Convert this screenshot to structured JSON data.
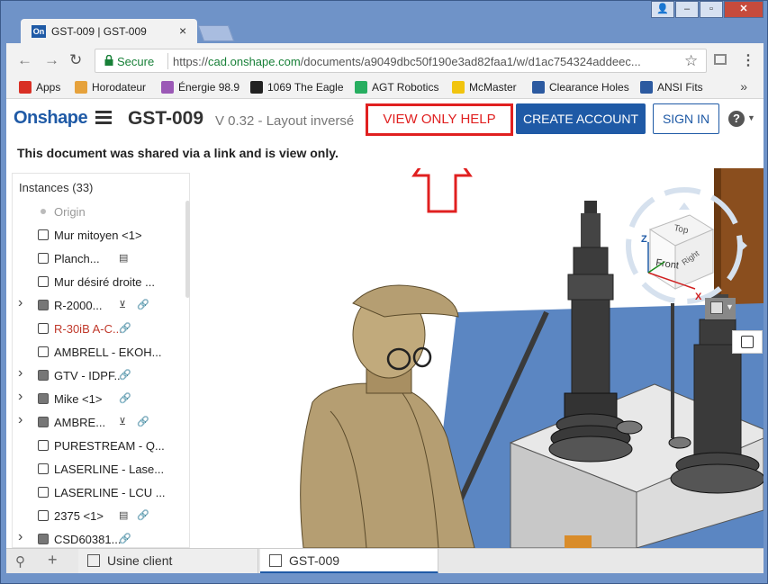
{
  "browser": {
    "tab_title": "GST-009 | GST-009",
    "tab_favicon": "On",
    "secure_label": "Secure",
    "url_prefix": "https://",
    "url_host": "cad.onshape.com",
    "url_path": "/documents/a9049dbc50f190e3ad82faa1/w/d1ac754324addeec..."
  },
  "bookmarks": [
    {
      "label": "Apps",
      "icon": "apps-grid-icon",
      "color": "#d93025"
    },
    {
      "label": "Horodateur",
      "icon": "clock-icon",
      "color": "#e6a23c"
    },
    {
      "label": "Énergie 98.9",
      "icon": "radio-icon",
      "color": "#9b59b6"
    },
    {
      "label": "1069 The Eagle",
      "icon": "radio-icon",
      "color": "#222222"
    },
    {
      "label": "AGT Robotics",
      "icon": "agt-icon",
      "color": "#27ae60"
    },
    {
      "label": "McMaster",
      "icon": "mcmaster-icon",
      "color": "#f1c40f"
    },
    {
      "label": "Clearance Holes",
      "icon": "globe-icon",
      "color": "#2c5aa0"
    },
    {
      "label": "ANSI Fits",
      "icon": "globe-icon",
      "color": "#2c5aa0"
    }
  ],
  "header": {
    "logo": "Onshape",
    "doc_title": "GST-009",
    "doc_version": "V 0.32 - Layout inversé",
    "view_only_help": "VIEW ONLY HELP",
    "create_account": "CREATE ACCOUNT",
    "sign_in": "SIGN IN",
    "help_icon": "?"
  },
  "shared_message": "This document was shared via a link and is view only.",
  "instances": {
    "title": "Instances (33)",
    "items": [
      {
        "label": "Origin",
        "type": "origin",
        "expandable": false,
        "style": "muted",
        "tags": []
      },
      {
        "label": "Mur mitoyen <1>",
        "type": "part",
        "expandable": false,
        "style": "",
        "tags": []
      },
      {
        "label": "Planch...",
        "type": "part",
        "expandable": false,
        "style": "",
        "tags": [
          "fixed"
        ]
      },
      {
        "label": "Mur désiré droite ...",
        "type": "part",
        "expandable": false,
        "style": "",
        "tags": []
      },
      {
        "label": "R-2000...",
        "type": "asm",
        "expandable": true,
        "style": "",
        "tags": [
          "ground",
          "link"
        ]
      },
      {
        "label": "R-30iB A-C...",
        "type": "part",
        "expandable": false,
        "style": "red",
        "tags": [
          "link"
        ]
      },
      {
        "label": "AMBRELL - EKOH...",
        "type": "part",
        "expandable": false,
        "style": "",
        "tags": []
      },
      {
        "label": "GTV - IDPF...",
        "type": "asm",
        "expandable": true,
        "style": "",
        "tags": [
          "link"
        ]
      },
      {
        "label": "Mike <1>",
        "type": "asm",
        "expandable": true,
        "style": "",
        "tags": [
          "link"
        ]
      },
      {
        "label": "AMBRE...",
        "type": "asm",
        "expandable": true,
        "style": "",
        "tags": [
          "ground",
          "link"
        ]
      },
      {
        "label": "PURESTREAM - Q...",
        "type": "part",
        "expandable": false,
        "style": "",
        "tags": []
      },
      {
        "label": "LASERLINE - Lase...",
        "type": "part",
        "expandable": false,
        "style": "",
        "tags": []
      },
      {
        "label": "LASERLINE - LCU ...",
        "type": "part",
        "expandable": false,
        "style": "",
        "tags": []
      },
      {
        "label": "2375 <1>",
        "type": "part",
        "expandable": false,
        "style": "",
        "tags": [
          "fixed",
          "link"
        ]
      },
      {
        "label": "CSD60381...",
        "type": "asm",
        "expandable": true,
        "style": "",
        "tags": [
          "link"
        ]
      }
    ]
  },
  "viewcube": {
    "top": "Top",
    "front": "Front",
    "right": "Right",
    "axis_z": "Z",
    "axis_x": "X"
  },
  "bottom_tabs": [
    {
      "label": "Usine client",
      "active": false
    },
    {
      "label": "GST-009",
      "active": true
    }
  ],
  "colors": {
    "brand": "#1f5aa6",
    "annotation": "#e02020",
    "secure": "#188038",
    "mannequin": "#b59e72",
    "machine": "#3a3a3a",
    "wood": "#8a4e1e",
    "floor": "#5b86c2"
  }
}
